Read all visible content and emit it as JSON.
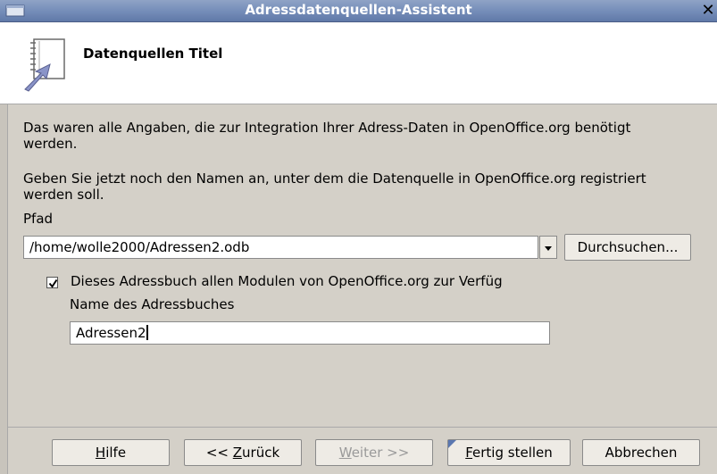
{
  "window": {
    "title": "Adressdatenquellen-Assistent",
    "close_glyph": "✕"
  },
  "header": {
    "title": "Datenquellen Titel",
    "icon": "address-book-arrow-icon"
  },
  "content": {
    "paragraph1": "Das waren alle Angaben, die zur Integration Ihrer Adress-Daten in OpenOffice.org benötigt werden.",
    "paragraph2": "Geben Sie jetzt noch den Namen an, unter dem die Datenquelle in OpenOffice.org registriert werden soll.",
    "path_label": "Pfad",
    "path_value": "/home/wolle2000/Adressen2.odb",
    "browse_label": "Durchsuchen...",
    "checkbox_label": "Dieses Adressbuch allen Modulen von OpenOffice.org zur Verfüg",
    "checkbox_checked": true,
    "name_label": "Name des Adressbuches",
    "name_value": "Adressen2"
  },
  "buttons": {
    "help_pre": "",
    "help_accel": "H",
    "help_post": "ilfe",
    "back_pre": "<< ",
    "back_accel": "Z",
    "back_post": "urück",
    "next_pre": "",
    "next_accel": "W",
    "next_post": "eiter >>",
    "finish_pre": "",
    "finish_accel": "F",
    "finish_post": "ertig stellen",
    "cancel_label": "Abbrechen"
  },
  "colors": {
    "titlebar": "#7890bb",
    "dialog_bg": "#d4d0c8",
    "disabled_text": "#9a9a9a"
  }
}
